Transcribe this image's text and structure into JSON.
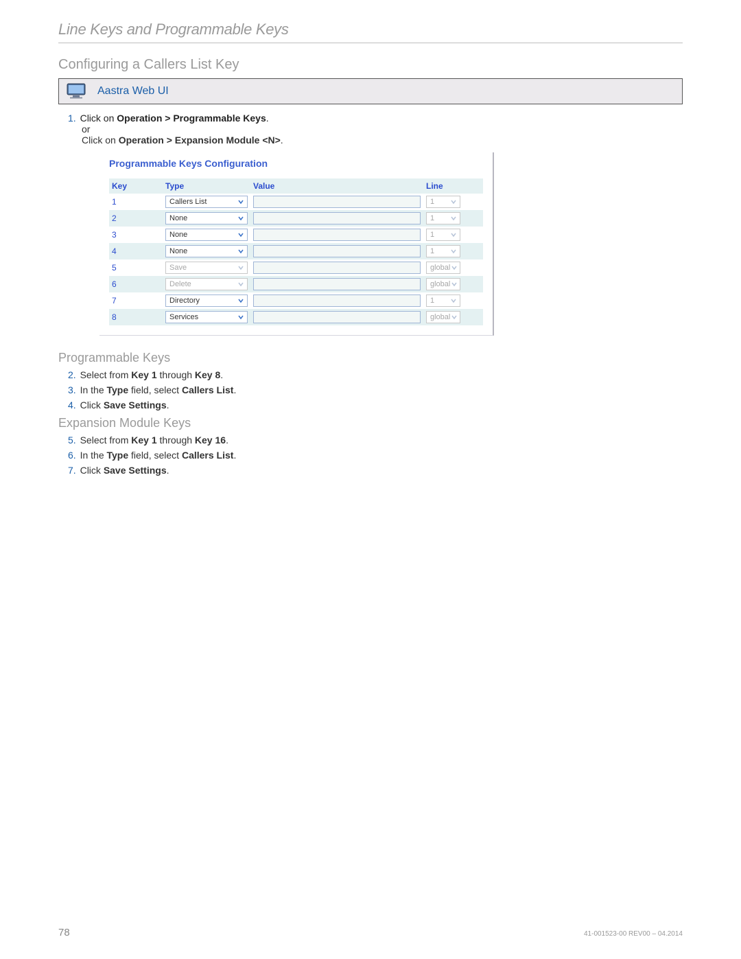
{
  "header": {
    "breadcrumb": "Line Keys and Programmable Keys"
  },
  "section": {
    "title": "Configuring a Callers List Key",
    "callout_label": "Aastra Web UI"
  },
  "step1": {
    "num": "1.",
    "pre": "Click on ",
    "b1": "Operation > Programmable Keys",
    "post": ".",
    "or": "or",
    "alt_pre": "Click on ",
    "alt_b1": "Operation > Expansion Module <N>",
    "alt_post": "."
  },
  "app": {
    "title": "Programmable Keys Configuration",
    "columns": {
      "key": "Key",
      "type": "Type",
      "value": "Value",
      "line": "Line"
    },
    "rows": [
      {
        "key": "1",
        "type": "Callers List",
        "line": "1",
        "type_disabled": false,
        "line_disabled": true
      },
      {
        "key": "2",
        "type": "None",
        "line": "1",
        "type_disabled": false,
        "line_disabled": true
      },
      {
        "key": "3",
        "type": "None",
        "line": "1",
        "type_disabled": false,
        "line_disabled": true
      },
      {
        "key": "4",
        "type": "None",
        "line": "1",
        "type_disabled": false,
        "line_disabled": true
      },
      {
        "key": "5",
        "type": "Save",
        "line": "global",
        "type_disabled": true,
        "line_disabled": true
      },
      {
        "key": "6",
        "type": "Delete",
        "line": "global",
        "type_disabled": true,
        "line_disabled": true
      },
      {
        "key": "7",
        "type": "Directory",
        "line": "1",
        "type_disabled": false,
        "line_disabled": true
      },
      {
        "key": "8",
        "type": "Services",
        "line": "global",
        "type_disabled": false,
        "line_disabled": true
      }
    ]
  },
  "prog": {
    "heading": "Programmable Keys",
    "s2": {
      "num": "2.",
      "a": "Select from ",
      "b": "Key 1",
      "c": " through ",
      "d": "Key 8",
      "e": "."
    },
    "s3": {
      "num": "3.",
      "a": "In the ",
      "b": "Type",
      "c": " field, select ",
      "d": "Callers List",
      "e": "."
    },
    "s4": {
      "num": "4.",
      "a": "Click ",
      "b": "Save Settings",
      "c": "."
    }
  },
  "exp": {
    "heading": "Expansion Module Keys",
    "s5": {
      "num": "5.",
      "a": "Select from ",
      "b": "Key 1",
      "c": " through ",
      "d": "Key 16",
      "e": "."
    },
    "s6": {
      "num": "6.",
      "a": "In the ",
      "b": "Type",
      "c": " field, select ",
      "d": "Callers List",
      "e": "."
    },
    "s7": {
      "num": "7.",
      "a": " Click ",
      "b": "Save Settings",
      "c": "."
    }
  },
  "footer": {
    "page": "78",
    "docid": "41-001523-00 REV00 – 04.2014"
  }
}
